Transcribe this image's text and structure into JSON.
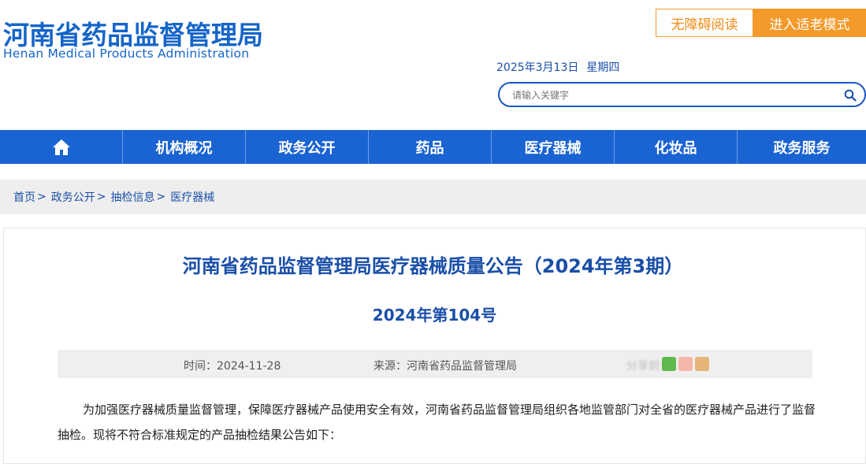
{
  "header": {
    "logo_cn": "河南省药品监督管理局",
    "logo_en": "Henan Medical Products Administration",
    "accessibility_label": "无障碍阅读",
    "elder_mode_label": "进入适老模式",
    "date": "2025年3月13日",
    "weekday": "星期四",
    "search_placeholder": "请输入关键字"
  },
  "nav": {
    "home_icon": "home-icon",
    "items": [
      "机构概况",
      "政务公开",
      "药品",
      "医疗器械",
      "化妆品",
      "政务服务"
    ]
  },
  "breadcrumb": {
    "items": [
      "首页",
      "政务公开",
      "抽检信息",
      "医疗器械"
    ],
    "separator": ">"
  },
  "article": {
    "title": "河南省药品监督管理局医疗器械质量公告（2024年第3期）",
    "doc_number": "2024年第104号",
    "time_label": "时间：2024-11-28",
    "source_label": "来源：河南省药品监督管理局",
    "share_label": "分享到：",
    "share_icons": [
      "wechat-icon",
      "weibo-icon",
      "qzone-icon"
    ],
    "body": "为加强医疗器械质量监督管理，保障医疗器械产品使用安全有效，河南省药品监督管理局组织各地监管部门对全省的医疗器械产品进行了监督抽检。现将不符合标准规定的产品抽检结果公告如下："
  },
  "colors": {
    "brand_blue": "#1a63d2",
    "accent_orange": "#f39a2a"
  }
}
